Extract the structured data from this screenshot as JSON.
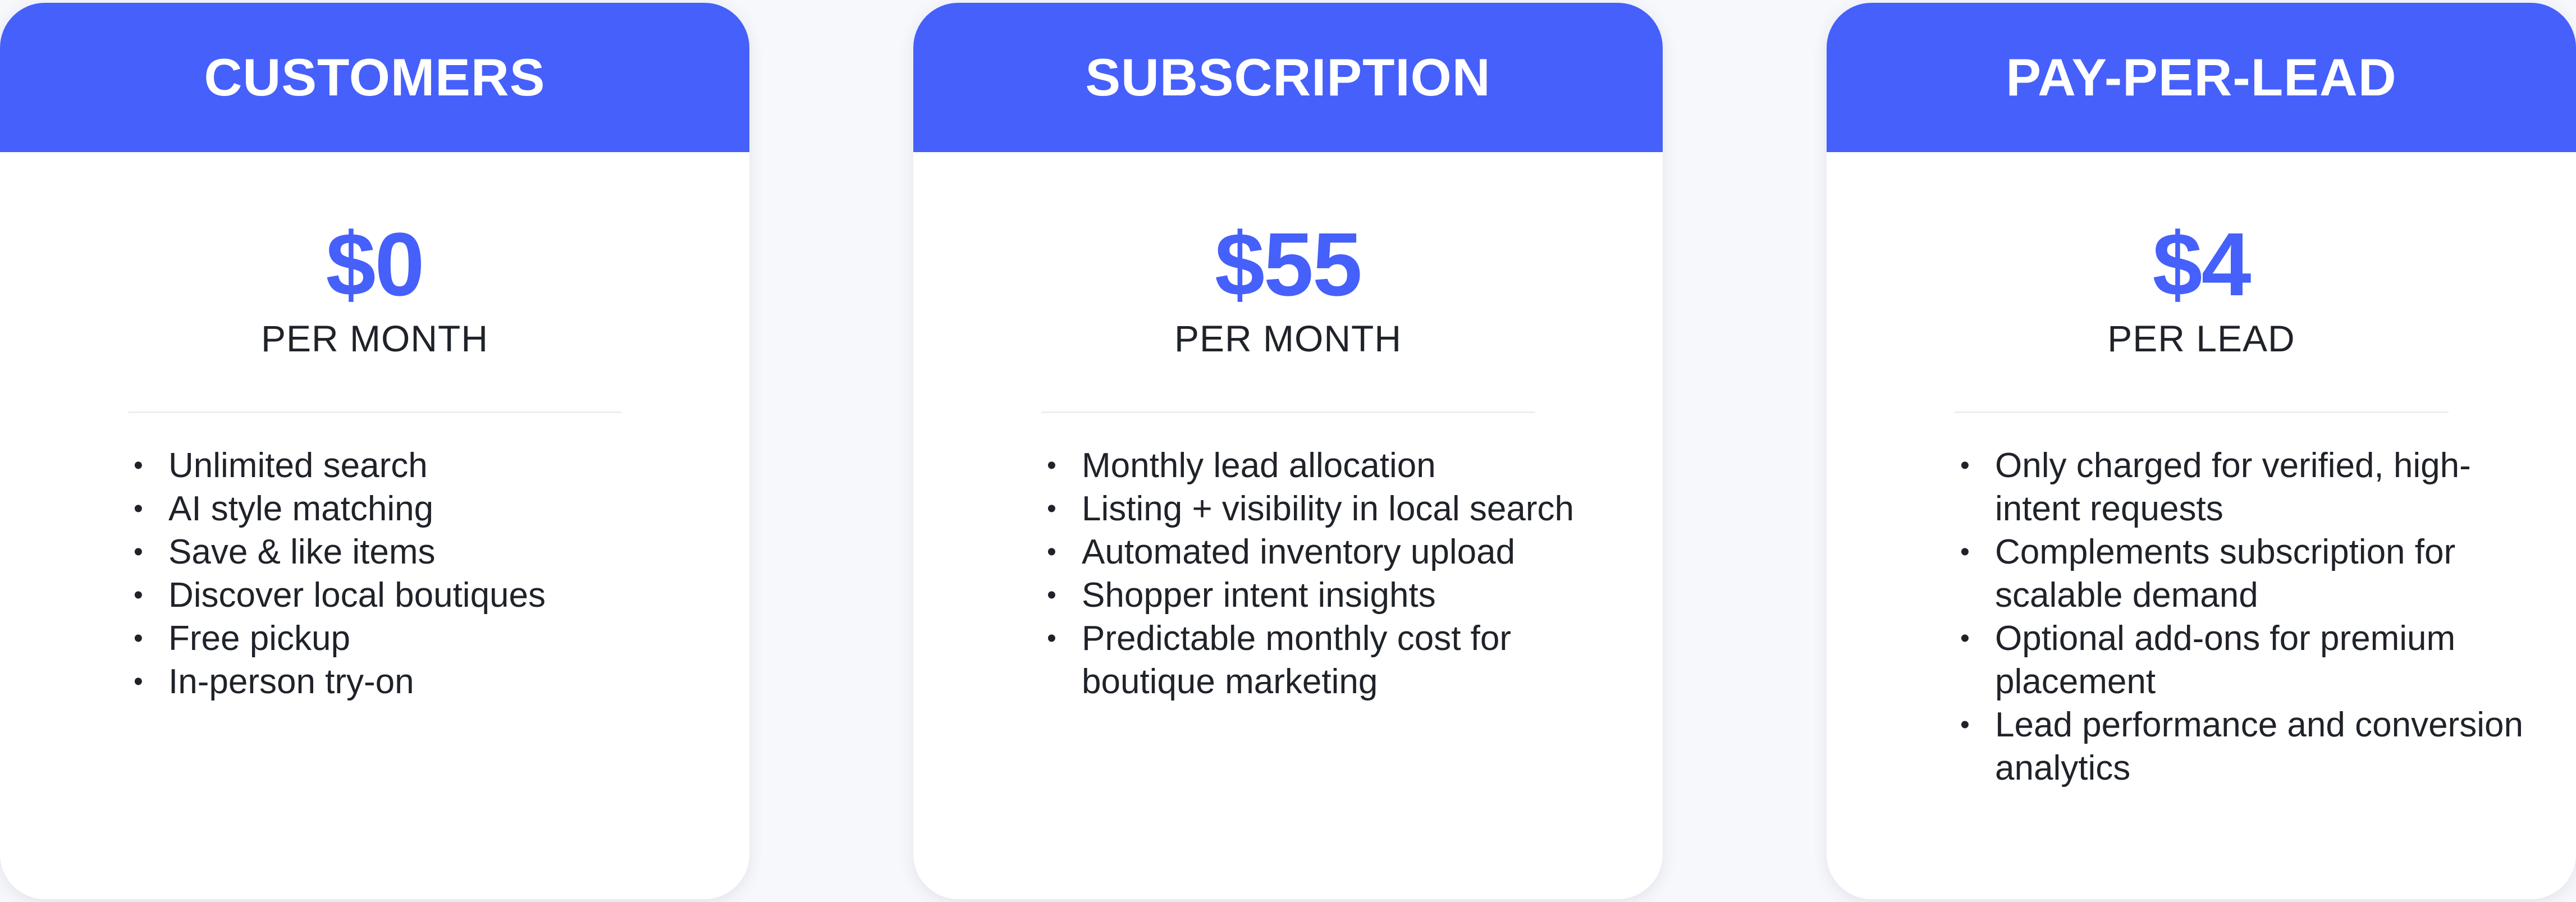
{
  "colors": {
    "accent": "#4660fb",
    "card_background": "#ffffff",
    "page_background": "#f7f8fc",
    "text": "#1f2329"
  },
  "plans": [
    {
      "title": "CUSTOMERS",
      "price": "$0",
      "period": "PER MONTH",
      "features": [
        "Unlimited search",
        "AI style matching",
        "Save & like items",
        "Discover local boutiques",
        "Free pickup",
        "In-person try-on"
      ]
    },
    {
      "title": "SUBSCRIPTION",
      "price": "$55",
      "period": "PER MONTH",
      "features": [
        "Monthly lead allocation",
        "Listing + visibility in local search",
        "Automated inventory upload",
        "Shopper intent insights",
        "Predictable monthly cost for boutique marketing"
      ]
    },
    {
      "title": "PAY-PER-LEAD",
      "price": "$4",
      "period": "PER LEAD",
      "features": [
        "Only charged for verified, high-intent requests",
        "Complements subscription for scalable demand",
        "Optional add-ons for premium placement",
        "Lead performance and conversion analytics"
      ]
    }
  ]
}
